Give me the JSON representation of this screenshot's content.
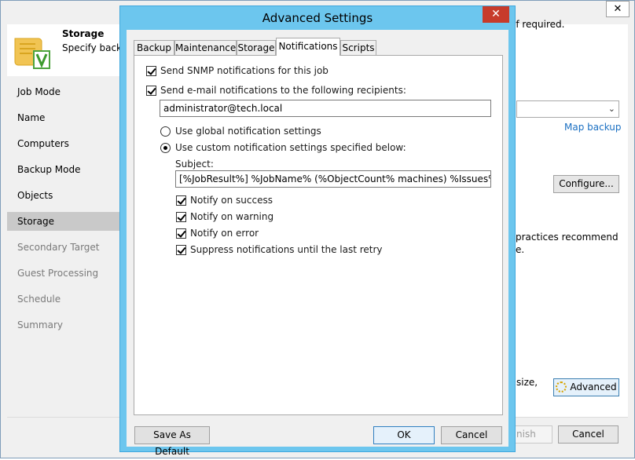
{
  "background_window": {
    "close_glyph": "✕",
    "header": {
      "title": "Storage",
      "description": "Specify backu",
      "description_tail": "if required."
    },
    "nav": [
      {
        "label": "Job Mode",
        "state": "normal"
      },
      {
        "label": "Name",
        "state": "normal"
      },
      {
        "label": "Computers",
        "state": "normal"
      },
      {
        "label": "Backup Mode",
        "state": "normal"
      },
      {
        "label": "Objects",
        "state": "normal"
      },
      {
        "label": "Storage",
        "state": "active"
      },
      {
        "label": "Secondary Target",
        "state": "dim"
      },
      {
        "label": "Guest Processing",
        "state": "dim"
      },
      {
        "label": "Schedule",
        "state": "dim"
      },
      {
        "label": "Summary",
        "state": "dim"
      }
    ],
    "map_backup_link": "Map backup",
    "configure_button": "Configure...",
    "practices_line1": "practices recommend",
    "practices_line2": "e.",
    "size_text": "size,",
    "advanced_button": "Advanced",
    "finish_button": "nish",
    "cancel_button": "Cancel"
  },
  "dialog": {
    "title": "Advanced Settings",
    "close_glyph": "✕",
    "tabs": [
      {
        "label": "Backup",
        "active": false
      },
      {
        "label": "Maintenance",
        "active": false
      },
      {
        "label": "Storage",
        "active": false
      },
      {
        "label": "Notifications",
        "active": true
      },
      {
        "label": "Scripts",
        "active": false
      }
    ],
    "snmp_label": "Send SNMP notifications for this job",
    "email_label": "Send e-mail notifications to the following recipients:",
    "recipients_value": "administrator@tech.local",
    "global_settings_label": "Use global notification settings",
    "custom_settings_label": "Use custom notification settings specified below:",
    "subject_label": "Subject:",
    "subject_value": "[%JobResult%] %JobName% (%ObjectCount% machines) %Issues%",
    "notify_success": "Notify on success",
    "notify_warning": "Notify on warning",
    "notify_error": "Notify on error",
    "suppress": "Suppress notifications until the last retry",
    "save_default_button": "Save As Default",
    "ok_button": "OK",
    "cancel_button": "Cancel"
  },
  "colors": {
    "dialog_frame": "#6cc6ee",
    "close_red": "#c73b2b",
    "link_blue": "#1a6fc2"
  }
}
